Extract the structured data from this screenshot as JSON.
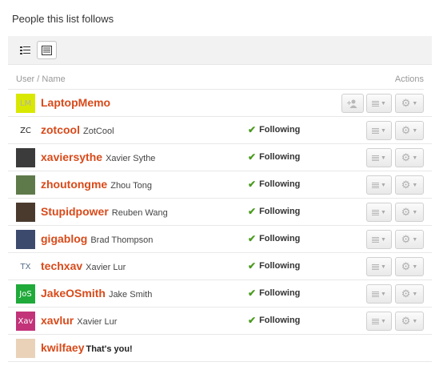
{
  "page": {
    "heading": "People this list follows"
  },
  "columns": {
    "user": "User / Name",
    "actions": "Actions"
  },
  "rows": [
    {
      "username": "LaptopMemo",
      "realname": "",
      "status": "",
      "avatar": {
        "text": "LM",
        "bg": "#d9e800",
        "fg": "#b0b0b0"
      }
    },
    {
      "username": "zotcool",
      "realname": "ZotCool",
      "status": "Following",
      "avatar": {
        "text": "ZC",
        "bg": "#ffffff",
        "fg": "#222222"
      }
    },
    {
      "username": "xaviersythe",
      "realname": "Xavier Sythe",
      "status": "Following",
      "avatar": {
        "text": "",
        "bg": "#3b3b3b",
        "fg": "#ffffff"
      }
    },
    {
      "username": "zhoutongme",
      "realname": "Zhou Tong",
      "status": "Following",
      "avatar": {
        "text": "",
        "bg": "#5f7a4a",
        "fg": "#ffffff"
      }
    },
    {
      "username": "Stupidpower",
      "realname": "Reuben Wang",
      "status": "Following",
      "avatar": {
        "text": "",
        "bg": "#4a3a2e",
        "fg": "#ffffff"
      }
    },
    {
      "username": "gigablog",
      "realname": "Brad Thompson",
      "status": "Following",
      "avatar": {
        "text": "",
        "bg": "#3c4a6e",
        "fg": "#ffffff"
      }
    },
    {
      "username": "techxav",
      "realname": "Xavier Lur",
      "status": "Following",
      "avatar": {
        "text": "TX",
        "bg": "#ffffff",
        "fg": "#5a6f8a"
      }
    },
    {
      "username": "JakeOSmith",
      "realname": "Jake Smith",
      "status": "Following",
      "avatar": {
        "text": "JoS",
        "bg": "#1faa3a",
        "fg": "#ffffff"
      }
    },
    {
      "username": "xavlur",
      "realname": "Xavier Lur",
      "status": "Following",
      "avatar": {
        "text": "Xav",
        "bg": "#c2337a",
        "fg": "#ffffff"
      }
    },
    {
      "username": "kwilfaey",
      "realname": "",
      "self_label": "That's you!",
      "status": "",
      "avatar": {
        "text": "",
        "bg": "#e9d2b8",
        "fg": "#ffffff"
      }
    }
  ],
  "colors": {
    "username": "#d84a1a",
    "check": "#4a9b1f"
  }
}
